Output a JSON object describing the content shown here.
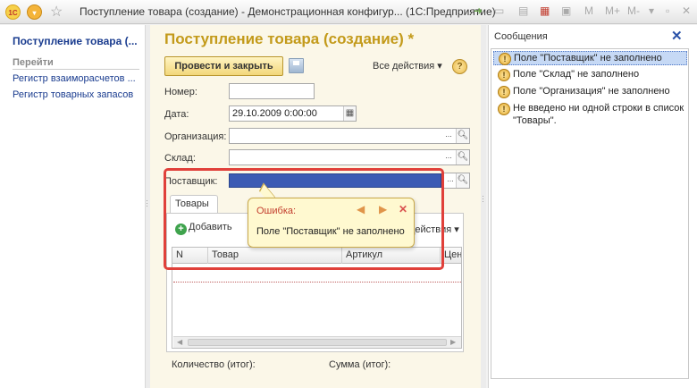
{
  "window": {
    "title": "Поступление товара (создание) - Демонстрационная конфигур...  (1С:Предприятие)",
    "logo_icon": "1c-logo-icon",
    "menu_icon": "main-menu-icon",
    "right_icons": [
      "forward-icon",
      "print-icon",
      "calendar-icon",
      "calc-icon",
      "M",
      "M+",
      "M-"
    ]
  },
  "nav": {
    "doc_title": "Поступление товара (...",
    "section_heading": "Перейти",
    "links": [
      "Регистр взаиморасчетов ...",
      "Регистр товарных запасов"
    ]
  },
  "form": {
    "title": "Поступление товара (создание) *",
    "post_close_label": "Провести и закрыть",
    "all_actions_label": "Все действия",
    "help_label": "?",
    "fields": {
      "number_label": "Номер:",
      "number_value": "",
      "date_label": "Дата:",
      "date_value": "29.10.2009  0:00:00",
      "org_label": "Организация:",
      "org_value": "",
      "warehouse_label": "Склад:",
      "warehouse_value": "",
      "supplier_label": "Поставщик:",
      "supplier_value": ""
    },
    "tab_label": "Товары",
    "add_label": "Добавить",
    "table_actions_label": "действия",
    "columns": [
      "N",
      "Товар",
      "Артикул",
      "Цена"
    ],
    "total_qty_label": "Количество (итог):",
    "total_sum_label": "Сумма (итог):"
  },
  "error_tip": {
    "title": "Ошибка:",
    "message": "Поле \"Поставщик\" не заполнено",
    "prev_icon": "arrow-left-icon",
    "next_icon": "arrow-right-icon",
    "close_icon": "close-icon"
  },
  "messages": {
    "title": "Сообщения",
    "items": [
      "Поле \"Поставщик\" не заполнено",
      "Поле \"Склад\" не заполнено",
      "Поле \"Организация\" не заполнено",
      "Не введено ни одной строки в список \"Товары\"."
    ],
    "selected_index": 0
  },
  "colors": {
    "form_title": "#c39a1a",
    "link": "#1a3c8f",
    "error_frame": "#e0403a",
    "supplier_field": "#3c5bb4",
    "tooltip_bg": "#fff9d0"
  }
}
